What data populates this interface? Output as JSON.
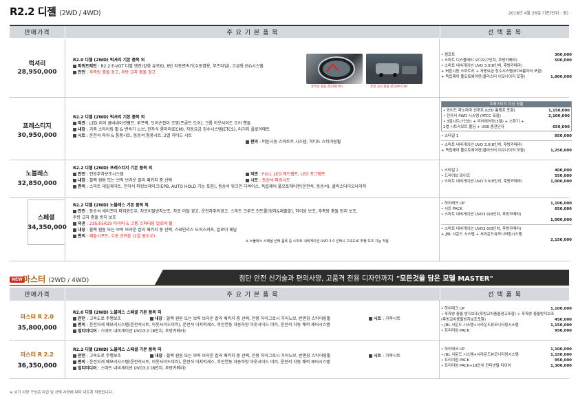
{
  "header": {
    "title": "R2.2 디젤",
    "title_sub": "(2WD / 4WD)",
    "date_note": "2018년 4월 26일 기준(단위 : 원)"
  },
  "columns": {
    "price": "판매가격",
    "basic": "주 요 기 본 품 목",
    "option": "선 택 품 목"
  },
  "trims": [
    {
      "name": "럭셔리",
      "price": "28,950,000",
      "basic_title": "R2.0 디젤 (2WD) 럭셔리 기본 품목 외",
      "lines": [
        {
          "label": "파워트레인",
          "text": " : R2.2 E-VGT 디젤 엔진(강화 유로6), 8단 자동변속기(수동겸용, 부츠타입), 고급형 ISG시스템"
        },
        {
          "label": "안전",
          "text": " : 후측방 충돌 경고, 후방 교차 충돌 경고"
        }
      ],
      "photo_caps": [
        "후측방 충돌 경고(BCW)",
        "후방 교차 충돌 경고(RCCW)"
      ],
      "options": [
        {
          "name": "• 컴포트",
          "price": "300,000"
        },
        {
          "name": "• 스마트 디스플레이 오디오(7인치, 후방카메라)",
          "price": "500,000"
        },
        {
          "name": "• 스마트 내비게이션 UVO 3.0(8인치, 후방카메라)",
          "price": ""
        },
        {
          "name": "   + 버튼시동 스마트키 + 자동요금 징수시스템(ECM룸미러 포함)",
          "price": ""
        },
        {
          "name": "   + 독립제어 풀오토에어컨(클러스터 이오나이저 포함)",
          "price": "1,800,000"
        }
      ]
    },
    {
      "name": "프레스티지",
      "price": "30,950,000",
      "basic_title": "R2.2 디젤 (2WD) 럭셔리 기본 품목 외",
      "lines": [
        {
          "label": "외관",
          "text": " : LED 리어 콤비네이션램프, 루프랙, 도어손잡이 조명(프론트 도어), 크롬 아웃사이드 도어 핸들"
        },
        {
          "label": "내장",
          "text": " : 가죽 스티어링 휠 & 변속기 노브, 전자식 룸미러(ECM), 자동요금 징수시스템(ETCS), 러기지 플로어매트"
        },
        {
          "label": "시트",
          "text": " : 운전석 파워 & 통풍시트, 동승석 통풍시트, 2열 히티드 시트"
        }
      ],
      "extra": {
        "label": "편의",
        "text": " : 버튼시동 스마트키 시스템, 히티드 스티어링휠"
      },
      "box_caption": "프레스티지 이상 공통",
      "box_options": [
        {
          "name": "• 와이드 파노라마 선루프 (LED 룸램프 포함)",
          "price": "1,150,000"
        },
        {
          "name": "• 전자식 4WD 시스템 (ATCC 포함)",
          "price": "2,100,000"
        },
        {
          "name": "• 3열시트(7인승) + 리어에어컨(3열) + 소화기 +",
          "price": ""
        },
        {
          "name": "   2열 시트리모트 폴딩 + USB 충전단자",
          "price": "650,000"
        }
      ],
      "options": [
        {
          "name": "• 스타일 1",
          "price": "950,000"
        },
        {
          "name": "• 스마트 내비게이션 UVO 3.0(8인치, 후방카메라)",
          "price": ""
        },
        {
          "name": "   + 독립제어 풀오토에어컨(클러스터 이오나이저 포함)",
          "price": "1,250,000"
        }
      ]
    },
    {
      "name": "노블레스",
      "price": "32,850,000",
      "basic_title": "R2.2 디젤 (2WD) 프레스티지 기본 품목 외",
      "lines": [
        {
          "label": "안전",
          "text": " : 전방주차보조시스템"
        },
        {
          "label": "내장",
          "text": " : 블랙 원톤 또는 브릭 브라운 칼라 패키지 중 선택"
        },
        {
          "label": "편의",
          "text": " : 스마트 테일게이트, 전자식 파킹브레이크(EPB, AUTO HOLD 기능 포함), 동승석 워크인 디바이스, 독립제어 풀오토에어컨(운전석, 동승석), 클러스터이오나이저"
        }
      ],
      "right_lines": [
        {
          "label": "외관",
          "text": " : FULL LED 헤드램프, LED 포그램프"
        },
        {
          "label": "시트",
          "text": " : 동승석 파워시트"
        }
      ],
      "options": [
        {
          "name": "• 스타일 2",
          "price": "400,000"
        },
        {
          "name": "• 드라이브 와이즈",
          "price": "550,000"
        },
        {
          "name": "• 스마트 내비게이션 UVO 3.0(8인치, 후방카메라)",
          "price": "1,000,000"
        }
      ]
    },
    {
      "name": "스페셜",
      "price": "34,350,000",
      "basic_title": "R2.2 디젤 (2WD) 노블레스 기본 품목 외",
      "lines": [
        {
          "label": "안전",
          "text": " : 동승석 세이프티 파워윈도우, 차로이탈방지보조, 차로 이탈 경고, 운전자주의경고, 스마트 크루즈 컨트롤(정차&재출발), 하이빔 보조, 후측방 충돌 방지 보조,"
        },
        {
          "label": "",
          "text": "       후방 교차 충돌 방지 보조"
        },
        {
          "label": "외관",
          "text": " : 235/55R19 타이어 & 크롬 스퍼터링 알로이 휠"
        },
        {
          "label": "내장",
          "text": " : 블랙 원톤 또는 브릭 브라운 칼라 패키지 중 선택, 스테인리스 도어스커프, 알로이 페달"
        },
        {
          "label": "편의",
          "text": " : 패들시프트, 수동 선커튼 (2열 원도우)"
        }
      ],
      "note": "※ 노블레스 스페셜 선택 품목 중 스마트 내비게이션 UVO 3.0 선택시 고속도로 주행 보조 기능 적용",
      "options": [
        {
          "name": "• 하이테크 UP",
          "price": "1,100,000"
        },
        {
          "name": "• 시트 PACK",
          "price": "650,000"
        },
        {
          "name": "• 스마트 내비게이션 UVO3.0(8인치, 후방카메라)",
          "price": ""
        },
        {
          "name": "",
          "price": "1,000,000"
        },
        {
          "name": "• 스마트 내비게이션 UVO3.0(8인치, 후방카메라)",
          "price": ""
        },
        {
          "name": "   + JBL 사운드 시스템 + 서라운드뷰모니터링시스템",
          "price": ""
        },
        {
          "name": "",
          "price": "2,150,000"
        }
      ]
    }
  ],
  "master": {
    "badge": "NEW",
    "title": "마스터",
    "title_sub": "(2WD / 4WD)",
    "banner": "첨단 안전 신기술과 편의사양, 고품격 전용 디자인까지",
    "banner_accent": "\"모든것을 담은 모델 MASTER\"",
    "trims": [
      {
        "name": "마스터 R 2.0",
        "price": "35,800,000",
        "basic_title": "R2.0 디젤 (2WD) 노블레스 스페셜 기본 품목 외",
        "lines": [
          {
            "label": "안전",
            "text": " : 고속도로 주행보조"
          },
          {
            "label": "편의",
            "text": " : 운전자세 메모리시스템(운전석시트, 아웃사이드미러), 운전석 이지억세스, 후진연동 자동하향 아웃사이드 미러, 운전석 자동 쾌적 제어시스템"
          },
          {
            "label": "멀티미디어",
            "text": " : 스마트 내비게이션 UVO3.0 (8인치, 후방카메라)"
          }
        ],
        "mid": {
          "label": "내장",
          "text": " : 블랙 원톤 또는 브릭 브라운 칼라 패키지 중 선택, 전용 하이그로시 가어노브, 반편칭 스티어링휠"
        },
        "right": {
          "label": "시트",
          "text": " : 가죽시트"
        },
        "options": [
          {
            "name": "• 하이테크 UP",
            "price": "1,100,000"
          },
          {
            "name": "• 후측방 충돌 방지보조(후방교차충돌경고포함) + 후측방 충돌방지보조",
            "price": ""
          },
          {
            "name": "   (후방교차충돌방지보조포함)",
            "price": "450,000"
          },
          {
            "name": "• JBL 사운드 시스템+서라운드뷰모니터링시스템",
            "price": "1,150,000"
          },
          {
            "name": "• 프리미엄 PACK",
            "price": "950,000"
          }
        ]
      },
      {
        "name": "마스터 R 2.2",
        "price": "36,350,000",
        "basic_title": "R2.2 디젤 (2WD) 노블레스 스페셜 기본 품목 외",
        "lines": [
          {
            "label": "안전",
            "text": " : 고속도로 주행보조"
          },
          {
            "label": "편의",
            "text": " : 운전자세 메모리시스템(운전석시트, 아웃사이드미러), 운전석 이지억세스, 후진연동 자동하향 아웃사이드 미러, 운전석 자동 쾌적 제어시스템"
          },
          {
            "label": "멀티미디어",
            "text": " : 스마트 내비게이션 UVO3.0 (8인치, 후방카메라)"
          }
        ],
        "mid": {
          "label": "내장",
          "text": " : 블랙 원톤 또는 브릭 브라운 칼라 패키지 중 선택, 전용 하이그로시 가어노브, 반편칭 스티어링휠"
        },
        "right": {
          "label": "시트",
          "text": " : 가죽시트"
        },
        "options": [
          {
            "name": "• 하이테크 UP",
            "price": "1,100,000"
          },
          {
            "name": "• JBL 사운드 시스템+서라운드뷰모니터링시스템",
            "price": "1,150,000"
          },
          {
            "name": "• 프리미엄 PACK",
            "price": "950,000"
          },
          {
            "name": "• 프리미엄 PACK+19인치 컨티넨탈 타이어",
            "price": "1,300,000"
          }
        ]
      }
    ]
  },
  "footnote": "※ 상기 사양 구성은 자급 및 선택 사양에 따라 다르게 적용됩니다."
}
